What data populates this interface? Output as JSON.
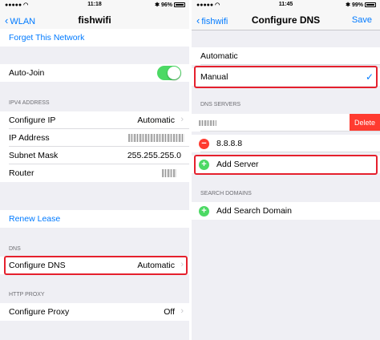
{
  "left": {
    "status": {
      "carrier": "",
      "time": "11:18",
      "battery": "96%"
    },
    "nav": {
      "back_label": "WLAN",
      "title": "fishwifi"
    },
    "forget_label": "Forget This Network",
    "auto_join_label": "Auto-Join",
    "auto_join_on": true,
    "ipv4_header": "IPV4 ADDRESS",
    "configure_ip": {
      "label": "Configure IP",
      "value": "Automatic"
    },
    "ip_address": {
      "label": "IP Address",
      "value": ""
    },
    "subnet": {
      "label": "Subnet Mask",
      "value": "255.255.255.0"
    },
    "router": {
      "label": "Router",
      "value": ""
    },
    "renew_label": "Renew Lease",
    "dns_header": "DNS",
    "configure_dns": {
      "label": "Configure DNS",
      "value": "Automatic"
    },
    "proxy_header": "HTTP PROXY",
    "configure_proxy": {
      "label": "Configure Proxy",
      "value": "Off"
    }
  },
  "right": {
    "status": {
      "carrier": "",
      "time": "11:45",
      "battery": "99%"
    },
    "nav": {
      "back_label": "fishwifi",
      "title": "Configure DNS",
      "save_label": "Save"
    },
    "automatic_label": "Automatic",
    "manual_label": "Manual",
    "dns_servers_header": "DNS SERVERS",
    "delete_label": "Delete",
    "server2": "8.8.8.8",
    "add_server_label": "Add Server",
    "search_domains_header": "SEARCH DOMAINS",
    "add_search_domain_label": "Add Search Domain"
  },
  "colors": {
    "accent": "#007aff",
    "toggle_on": "#4cd964",
    "destructive": "#ff3b30",
    "highlight": "#e5202d"
  }
}
